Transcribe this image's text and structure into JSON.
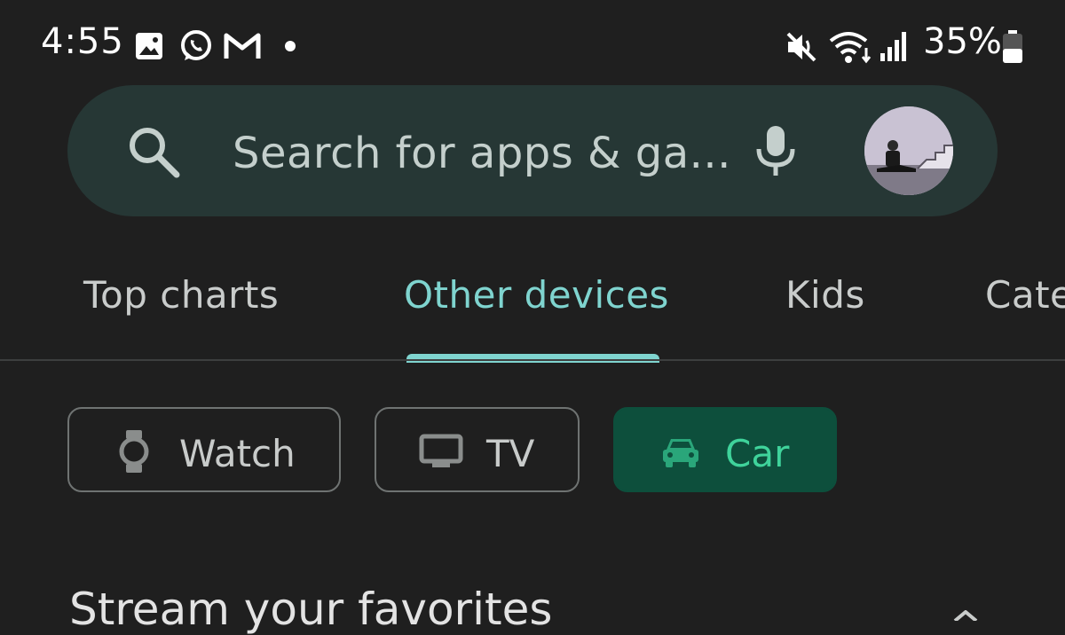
{
  "status_bar": {
    "time": "4:55",
    "battery": "35%",
    "icons": [
      "gallery-icon",
      "whatsapp-icon",
      "gmail-icon",
      "dot-icon",
      "vibrate-off-icon",
      "wifi-icon",
      "signal-icon",
      "battery-icon"
    ]
  },
  "search": {
    "placeholder": "Search for apps & ga...",
    "icons": [
      "search-icon",
      "mic-icon"
    ]
  },
  "tabs": [
    {
      "label": "Top charts",
      "active": false
    },
    {
      "label": "Other devices",
      "active": true
    },
    {
      "label": "Kids",
      "active": false
    },
    {
      "label": "Cate",
      "active": false
    }
  ],
  "chips": [
    {
      "label": "Watch",
      "icon": "watch-icon",
      "selected": false
    },
    {
      "label": "TV",
      "icon": "tv-icon",
      "selected": false
    },
    {
      "label": "Car",
      "icon": "car-icon",
      "selected": true
    }
  ],
  "section": {
    "title": "Stream your favorites"
  },
  "colors": {
    "background": "#1f1f1f",
    "search_bar": "#263735",
    "accent": "#7fd4cf",
    "chip_selected_bg": "#0d4f3c",
    "chip_selected_text": "#3fd39b"
  }
}
